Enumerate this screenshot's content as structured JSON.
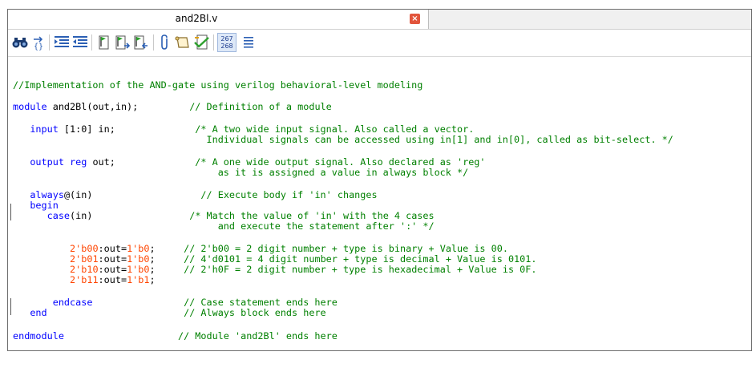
{
  "tab": {
    "title": "and2Bl.v",
    "close": "×"
  },
  "toolbar": {
    "line_numbers_top": "267",
    "line_numbers_bottom": "268"
  },
  "code": {
    "l1": {
      "comment": "//Implementation of the AND-gate using verilog behavioral-level modeling"
    },
    "l2": {
      "kw": "module",
      "rest": " and2Bl(out,in);",
      "pad": "         ",
      "comment": "// Definition of a module"
    },
    "l3": {
      "indent": "   ",
      "kw": "input",
      "rest": " [1:0] in;",
      "pad": "              ",
      "comment": "/* A two wide input signal. Also called a vector."
    },
    "l4": {
      "pad": "                                  ",
      "comment": "Individual signals can be accessed using in[1] and in[0], called as bit-select. */"
    },
    "l5": {
      "indent": "   ",
      "kw": "output reg",
      "rest": " out;",
      "pad": "              ",
      "comment": "/* A one wide output signal. Also declared as 'reg'"
    },
    "l6": {
      "pad": "                                    ",
      "comment": "as it is assigned a value in always block */"
    },
    "l7": {
      "indent": "   ",
      "kw": "always",
      "rest": "@(in)",
      "pad": "                   ",
      "comment": "// Execute body if 'in' changes"
    },
    "l8": {
      "indent": "   ",
      "kw": "begin"
    },
    "l9": {
      "indent": "      ",
      "kw": "case",
      "rest": "(in)",
      "pad": "                 ",
      "comment": "/* Match the value of 'in' with the 4 cases"
    },
    "l10": {
      "pad": "                                    ",
      "comment": "and execute the statement after ':' */"
    },
    "cases": [
      {
        "lhs": "2'b00",
        "mid": ":out=",
        "rhs": "1'b0",
        "end": ";",
        "pad": "     ",
        "comment": "// 2'b00 = 2 digit number + type is binary + Value is 00."
      },
      {
        "lhs": "2'b01",
        "mid": ":out=",
        "rhs": "1'b0",
        "end": ";",
        "pad": "     ",
        "comment": "// 4'd0101 = 4 digit number + type is decimal + Value is 0101."
      },
      {
        "lhs": "2'b10",
        "mid": ":out=",
        "rhs": "1'b0",
        "end": ";",
        "pad": "     ",
        "comment": "// 2'h0F = 2 digit number + type is hexadecimal + Value is 0F."
      },
      {
        "lhs": "2'b11",
        "mid": ":out=",
        "rhs": "1'b1",
        "end": ";",
        "pad": "",
        "comment": ""
      }
    ],
    "l15": {
      "indent": "       ",
      "kw": "endcase",
      "pad": "                ",
      "comment": "// Case statement ends here"
    },
    "l16": {
      "indent": "   ",
      "kw": "end",
      "pad": "                        ",
      "comment": "// Always block ends here"
    },
    "l17": {
      "kw": "endmodule",
      "pad": "                    ",
      "comment": "// Module 'and2Bl' ends here"
    }
  }
}
